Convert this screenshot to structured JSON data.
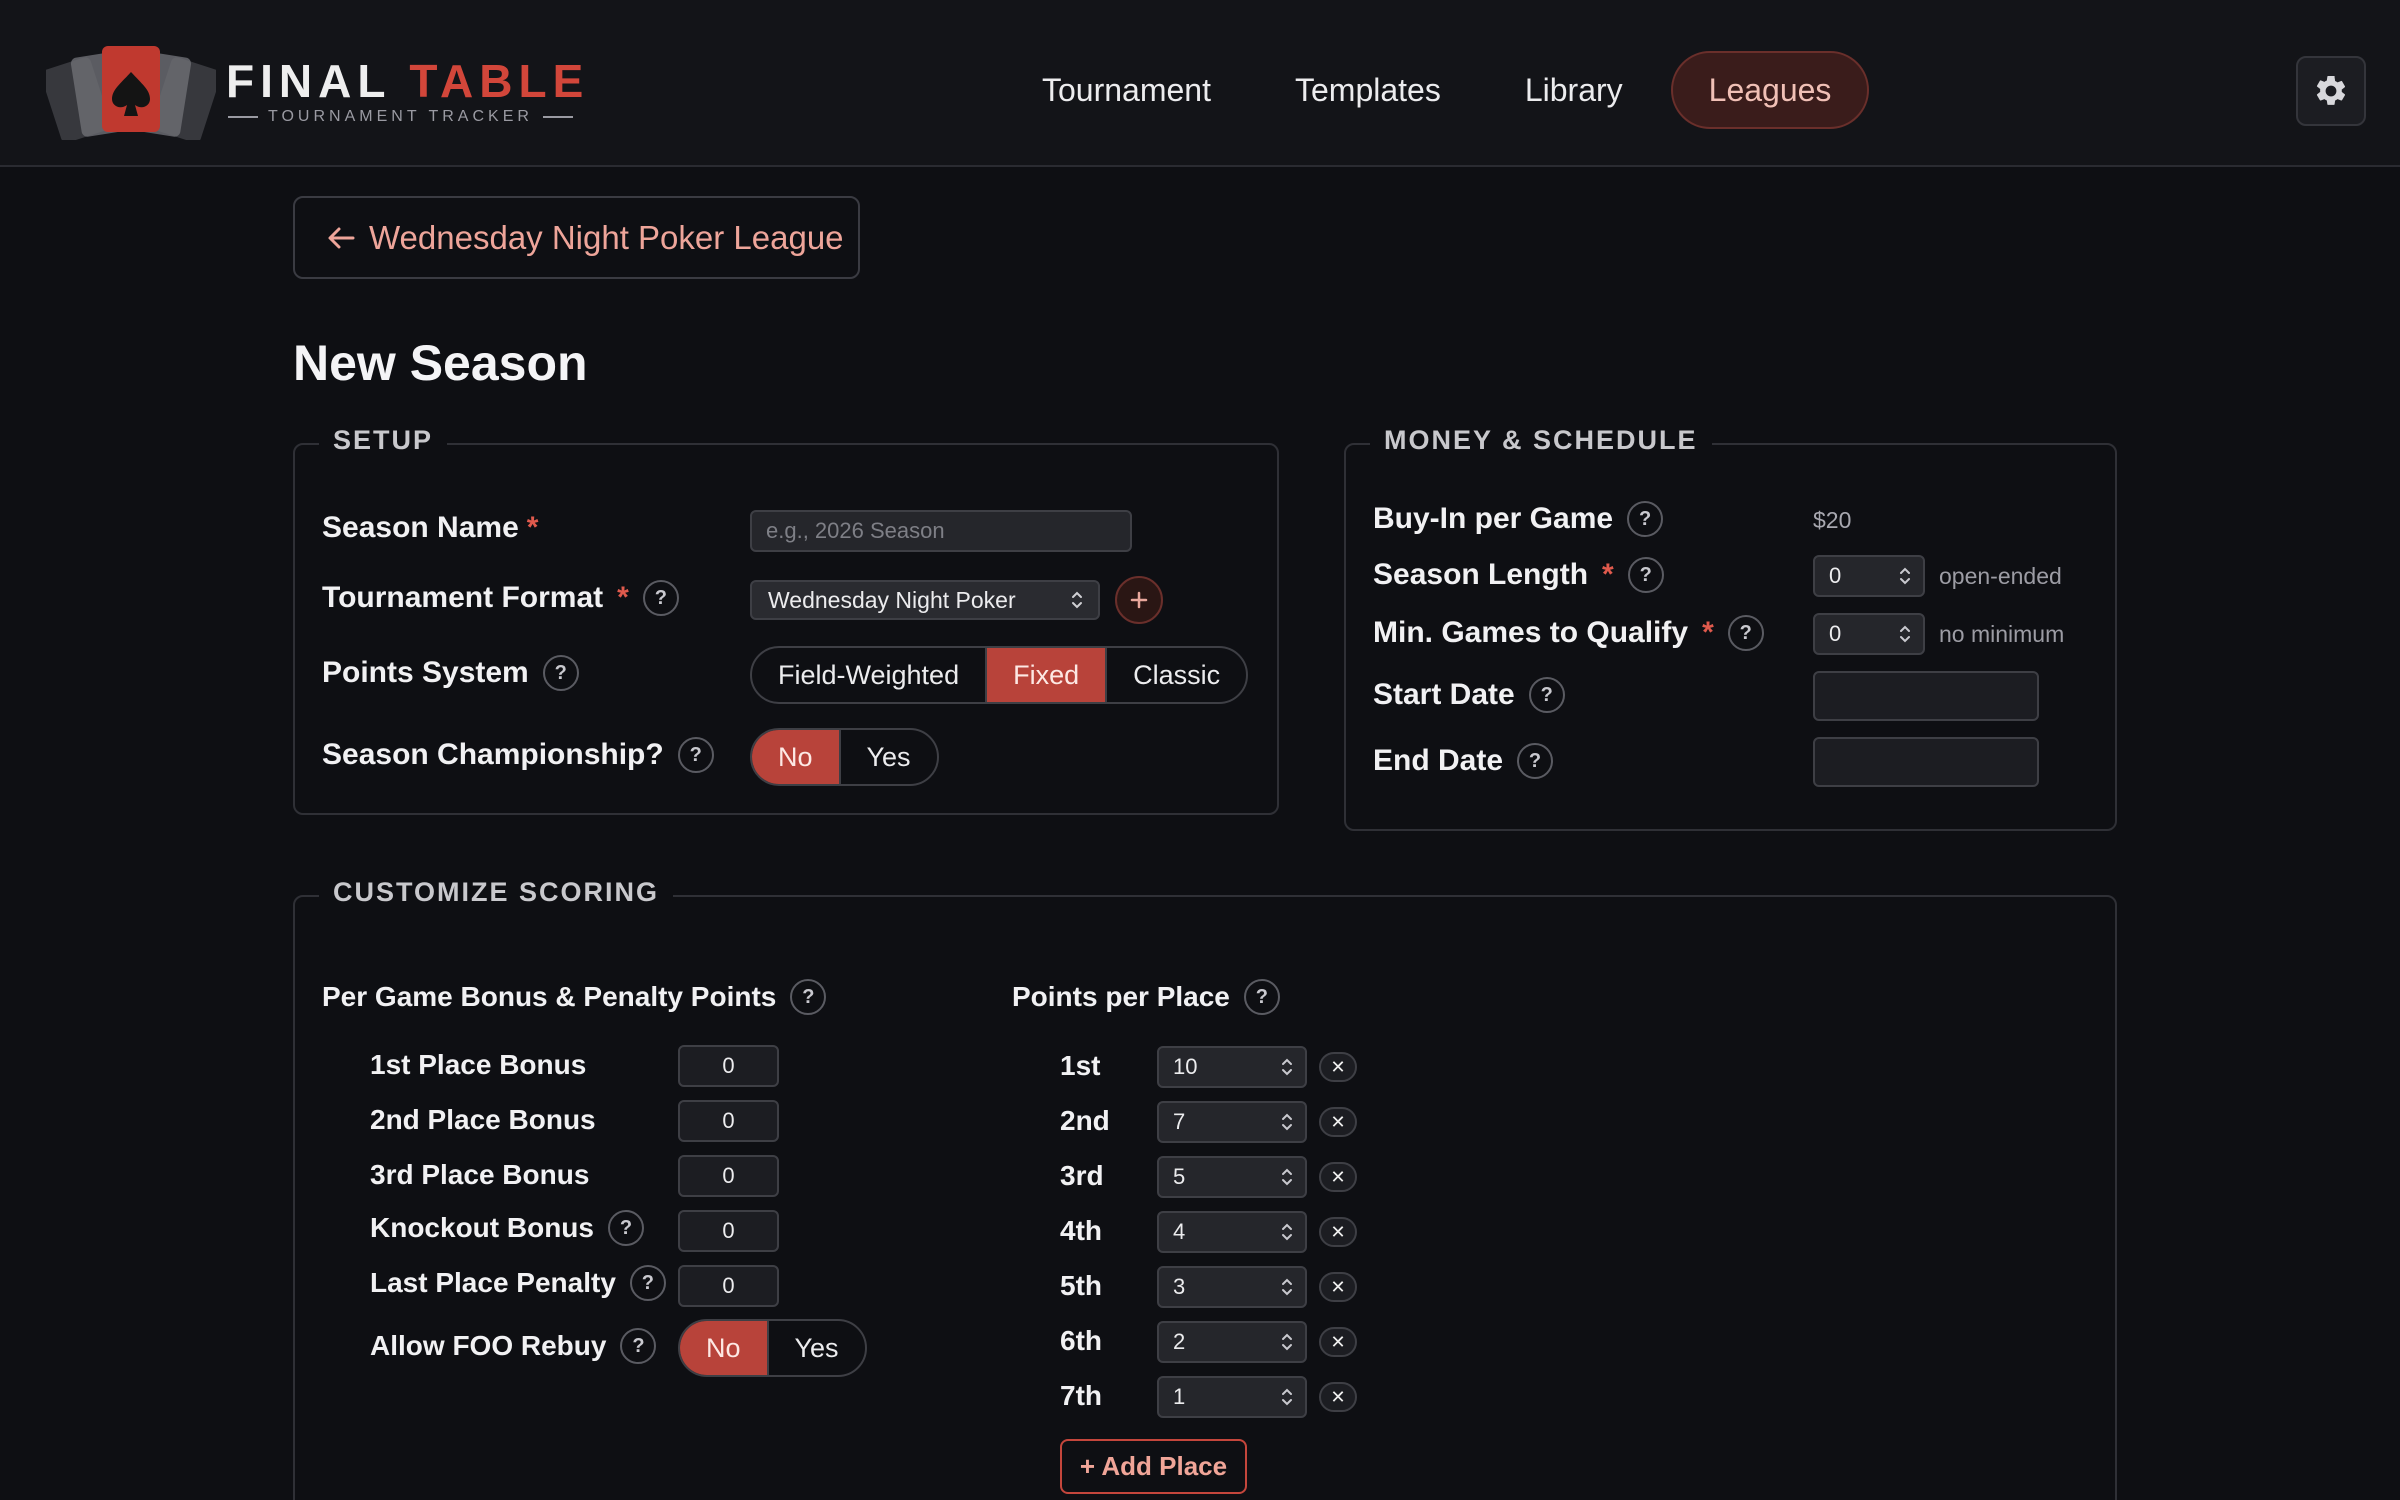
{
  "app": {
    "logo_word_1": "FINAL",
    "logo_word_2": "TABLE",
    "logo_tagline": "TOURNAMENT TRACKER",
    "brand_color": "#d2463a"
  },
  "nav": {
    "items": [
      {
        "label": "Tournament",
        "active": false
      },
      {
        "label": "Templates",
        "active": false
      },
      {
        "label": "Library",
        "active": false
      },
      {
        "label": "Leagues",
        "active": true
      }
    ],
    "settings_icon": "gear-icon"
  },
  "back_button": {
    "label": "Wednesday Night Poker League",
    "icon": "arrow-left-icon"
  },
  "page_title": "New Season",
  "setup": {
    "legend": "SETUP",
    "season_name": {
      "label": "Season Name",
      "required": "*",
      "value": "",
      "placeholder": "e.g., 2026 Season"
    },
    "tournament_format": {
      "label": "Tournament Format",
      "required": "*",
      "value": "Wednesday Night Poker",
      "add_icon": "plus-icon"
    },
    "points_system": {
      "label": "Points System",
      "options": [
        "Field-Weighted",
        "Fixed",
        "Classic"
      ],
      "selected": "Fixed"
    },
    "season_championship": {
      "label": "Season Championship?",
      "options": [
        "No",
        "Yes"
      ],
      "selected": "No"
    }
  },
  "money": {
    "legend": "MONEY & SCHEDULE",
    "buy_in": {
      "label": "Buy-In per Game",
      "value": "$20"
    },
    "season_length": {
      "label": "Season Length",
      "required": "*",
      "value": "0",
      "hint": "open-ended"
    },
    "min_games": {
      "label": "Min. Games to Qualify",
      "required": "*",
      "value": "0",
      "hint": "no minimum"
    },
    "start_date": {
      "label": "Start Date",
      "value": ""
    },
    "end_date": {
      "label": "End Date",
      "value": ""
    }
  },
  "scoring": {
    "legend": "CUSTOMIZE SCORING",
    "bonus_heading": "Per Game Bonus & Penalty Points",
    "bonuses": [
      {
        "label": "1st Place Bonus",
        "value": "0",
        "help": false
      },
      {
        "label": "2nd Place Bonus",
        "value": "0",
        "help": false
      },
      {
        "label": "3rd Place Bonus",
        "value": "0",
        "help": false
      },
      {
        "label": "Knockout Bonus",
        "value": "0",
        "help": true
      },
      {
        "label": "Last Place Penalty",
        "value": "0",
        "help": true
      }
    ],
    "foo_rebuy": {
      "label": "Allow FOO Rebuy",
      "options": [
        "No",
        "Yes"
      ],
      "selected": "No"
    },
    "places_heading": "Points per Place",
    "places": [
      {
        "label": "1st",
        "value": "10"
      },
      {
        "label": "2nd",
        "value": "7"
      },
      {
        "label": "3rd",
        "value": "5"
      },
      {
        "label": "4th",
        "value": "4"
      },
      {
        "label": "5th",
        "value": "3"
      },
      {
        "label": "6th",
        "value": "2"
      },
      {
        "label": "7th",
        "value": "1"
      }
    ],
    "add_place_label": "+ Add Place",
    "remove_symbol": "✕"
  },
  "help_symbol": "?"
}
